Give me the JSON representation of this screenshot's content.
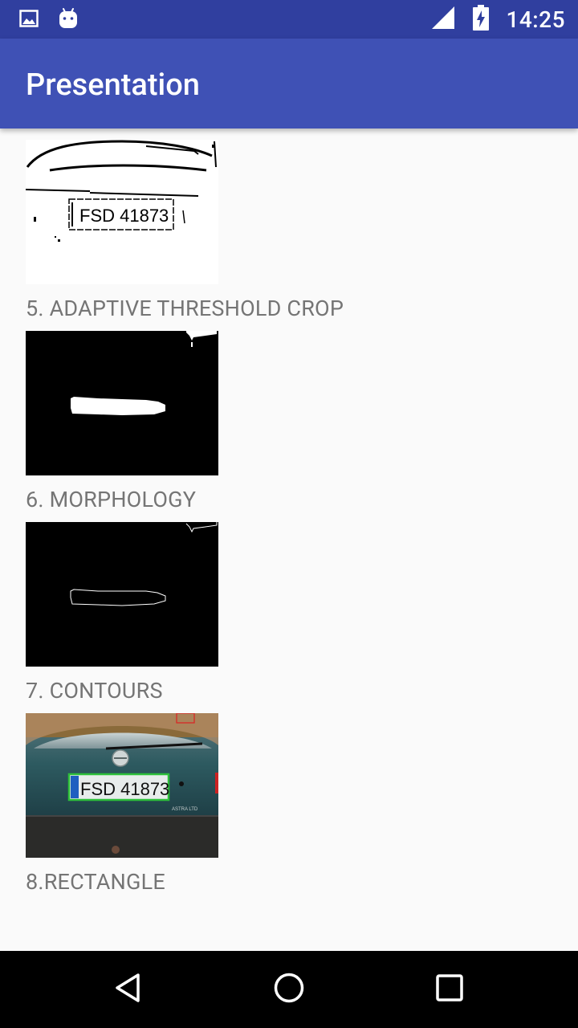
{
  "status_bar": {
    "time": "14:25",
    "icons": [
      "image-icon",
      "android-icon",
      "signal-icon",
      "battery-charging-icon"
    ]
  },
  "app_bar": {
    "title": "Presentation"
  },
  "steps": [
    {
      "caption": "5. ADAPTIVE THRESHOLD CROP",
      "plate_text": "FSD 41873"
    },
    {
      "caption": "6. MORPHOLOGY"
    },
    {
      "caption": "7. CONTOURS"
    },
    {
      "caption": "8.RECTANGLE",
      "plate_text": "FSD 41873",
      "car_text": "ASTRA LTD"
    }
  ],
  "nav_bar": {
    "icons": [
      "back-icon",
      "home-icon",
      "recents-icon"
    ]
  },
  "colors": {
    "status_bar": "#303f9f",
    "app_bar": "#3f51b5",
    "background": "#fafafa",
    "caption_text": "#757575",
    "nav_bar": "#000000"
  }
}
